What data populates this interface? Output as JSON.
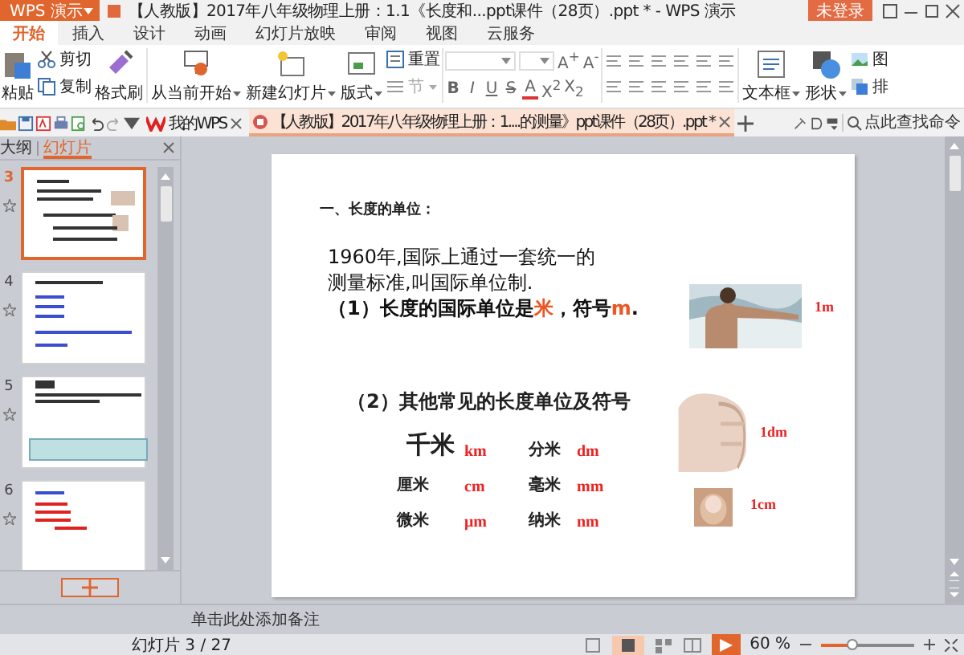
{
  "app_menu": {
    "label": "WPS 演示"
  },
  "window": {
    "title": "【人教版】2017年八年级物理上册：1.1《长度和...ppt课件（28页）.ppt * - WPS 演示",
    "login": "未登录"
  },
  "menu_tabs": [
    {
      "label": "开始",
      "selected": true
    },
    {
      "label": "插入",
      "selected": false
    },
    {
      "label": "设计",
      "selected": false
    },
    {
      "label": "动画",
      "selected": false
    },
    {
      "label": "幻灯片放映",
      "selected": false
    },
    {
      "label": "审阅",
      "selected": false
    },
    {
      "label": "视图",
      "selected": false
    },
    {
      "label": "云服务",
      "selected": false
    }
  ],
  "ribbon": {
    "paste": "粘贴",
    "cut": "剪切",
    "copy": "复制",
    "format_painter": "格式刷",
    "play_from_current": "从当前开始",
    "new_slide": "新建幻灯片",
    "layout": "版式",
    "reset": "重置",
    "section": {
      "label": "节",
      "disabled": true
    },
    "font_styles": [
      "B",
      "I",
      "U",
      "S"
    ],
    "font_color": "A",
    "scripts": [
      "X$^{2}$",
      "X$_{2}$"
    ],
    "size_buttons": [
      "A$^{+}$",
      "A$^{-}$"
    ],
    "text_box": "文本框",
    "shapes": "形状",
    "picture": "图",
    "arrange": "排"
  },
  "doc_tabs": [
    {
      "label": "我的WPS",
      "selected": false
    },
    {
      "label": "【人教版】2017年八年级物理上册：1....的测量》ppt课件（28页）.ppt *",
      "selected": true
    }
  ],
  "command_search": {
    "placeholder": "点此查找命令"
  },
  "side_panel": {
    "tabs": [
      {
        "label": "大纲",
        "selected": false
      },
      {
        "label": "幻灯片",
        "selected": true
      }
    ],
    "slides": [
      {
        "number": "3",
        "selected": true
      },
      {
        "number": "4",
        "selected": false
      },
      {
        "number": "5",
        "selected": false
      },
      {
        "number": "6",
        "selected": false
      }
    ]
  },
  "slide": {
    "heading": "一、长度的单位：",
    "intro": [
      "1960年,国际上通过一套统一的",
      "测量标准,叫国际单位制."
    ],
    "si_unit": [
      {
        "text": "（1）长度的国际单位是",
        "emphasis": false
      },
      {
        "text": "米",
        "emphasis": true
      },
      {
        "text": "，符号",
        "emphasis": false
      },
      {
        "text": "m",
        "emphasis": true
      },
      {
        "text": ".",
        "emphasis": false
      }
    ],
    "subheading": "（2）其他常见的长度单位及符号",
    "units": [
      {
        "name": "千米",
        "symbol": "km",
        "large": true
      },
      {
        "name": "分米",
        "symbol": "dm",
        "large": false
      },
      {
        "name": "厘米",
        "symbol": "cm",
        "large": false
      },
      {
        "name": "毫米",
        "symbol": "mm",
        "large": false
      },
      {
        "name": "微米",
        "symbol": "μm",
        "large": false
      },
      {
        "name": "纳米",
        "symbol": "nm",
        "large": false
      }
    ],
    "photos": [
      {
        "kind": "picture",
        "caption": "1m"
      },
      {
        "kind": "picture",
        "caption": "1dm"
      },
      {
        "kind": "picture",
        "caption": "1cm"
      }
    ]
  },
  "notes": {
    "placeholder": "单击此处添加备注"
  },
  "status_bar": {
    "slide_counter": "幻灯片 3 / 27",
    "zoom": "60 %",
    "zoom_slider": {
      "level": 0.35
    }
  }
}
